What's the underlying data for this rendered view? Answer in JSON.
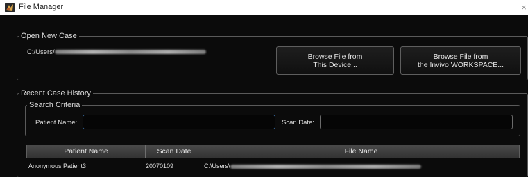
{
  "window": {
    "title": "File Manager",
    "close_glyph": "×"
  },
  "open_new_case": {
    "legend": "Open New Case",
    "path_prefix": "C:/Users/",
    "browse_device_line1": "Browse File from",
    "browse_device_line2": "This Device...",
    "browse_workspace_line1": "Browse File from",
    "browse_workspace_line2": "the Invivo WORKSPACE..."
  },
  "recent_history": {
    "legend": "Recent Case History",
    "search": {
      "legend": "Search Criteria",
      "patient_name_label": "Patient Name:",
      "patient_name_value": "",
      "scan_date_label": "Scan Date:",
      "scan_date_value": ""
    },
    "columns": [
      "Patient Name",
      "Scan Date",
      "File Name"
    ],
    "rows": [
      {
        "patient_name": "Anonymous Patient3",
        "scan_date": "20070109",
        "file_name_prefix": "C:\\Users\\"
      }
    ]
  }
}
